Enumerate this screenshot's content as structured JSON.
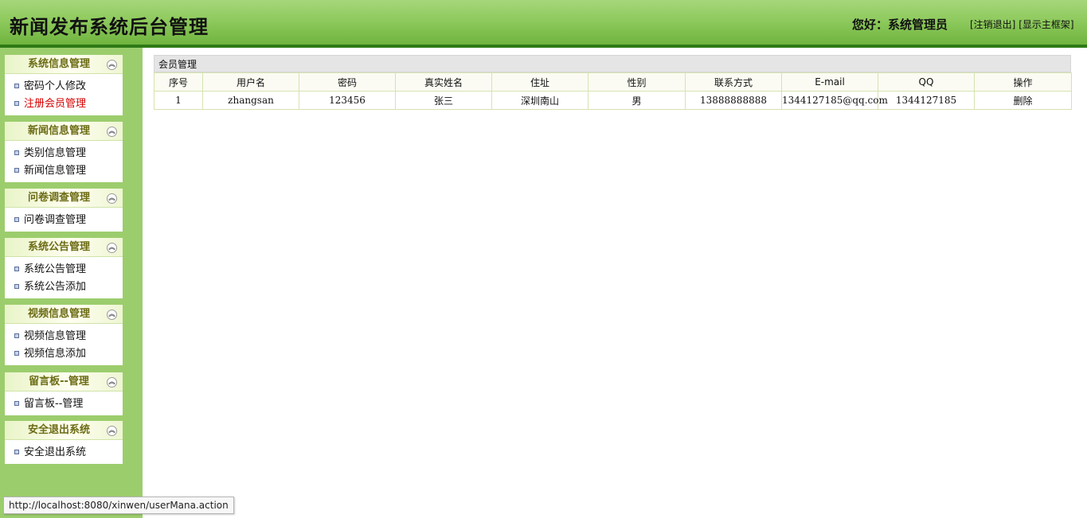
{
  "header": {
    "title": "新闻发布系统后台管理",
    "greeting": "您好：系统管理员",
    "logout_link": "[注销退出]",
    "show_frame_link": "[显示主框架]"
  },
  "sidebar": {
    "groups": [
      {
        "title": "系统信息管理",
        "items": [
          "密码个人修改",
          "注册会员管理"
        ]
      },
      {
        "title": "新闻信息管理",
        "items": [
          "类别信息管理",
          "新闻信息管理"
        ]
      },
      {
        "title": "问卷调查管理",
        "items": [
          "问卷调查管理"
        ]
      },
      {
        "title": "系统公告管理",
        "items": [
          "系统公告管理",
          "系统公告添加"
        ]
      },
      {
        "title": "视频信息管理",
        "items": [
          "视频信息管理",
          "视频信息添加"
        ]
      },
      {
        "title": "留言板--管理",
        "items": [
          "留言板--管理"
        ]
      },
      {
        "title": "安全退出系统",
        "items": [
          "安全退出系统"
        ]
      }
    ],
    "collapse_icon": "double-chevron-up-icon",
    "active_item": "注册会员管理"
  },
  "main": {
    "panel_title": "会员管理",
    "columns": [
      "序号",
      "用户名",
      "密码",
      "真实姓名",
      "住址",
      "性别",
      "联系方式",
      "E-mail",
      "QQ",
      "操作"
    ],
    "rows": [
      [
        "1",
        "zhangsan",
        "123456",
        "张三",
        "深圳南山",
        "男",
        "13888888888",
        "1344127185@qq.com",
        "1344127185",
        "删除"
      ]
    ]
  },
  "statusbar": {
    "url": "http://localhost:8080/xinwen/userMana.action"
  },
  "colors": {
    "header_green": "#8fca5e",
    "sidebar_green": "#9ccd6d",
    "active_item": "#d40000",
    "group_title": "#6b6b14"
  }
}
